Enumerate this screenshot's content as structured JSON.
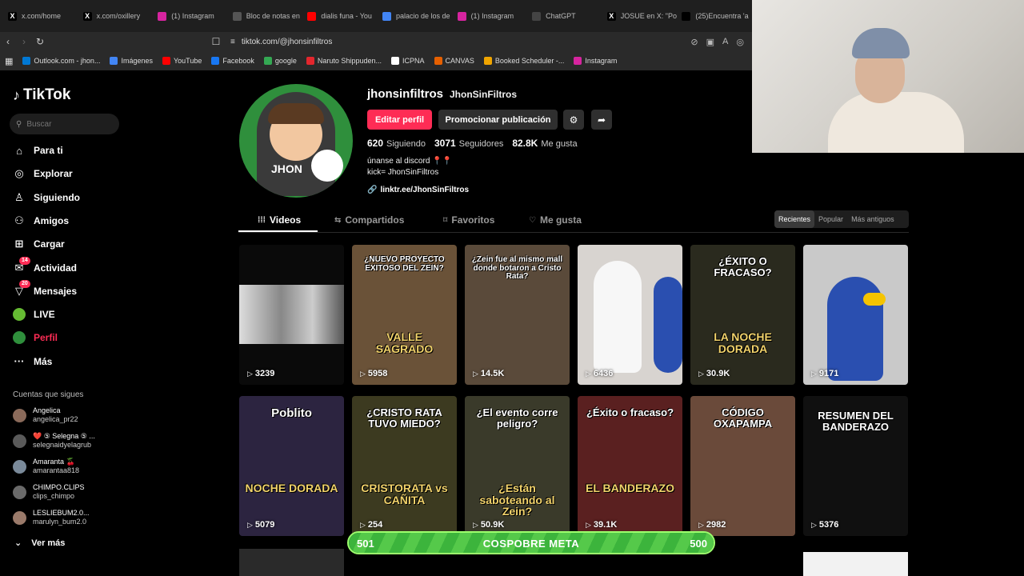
{
  "browser": {
    "tabs": [
      {
        "label": "x.com/home",
        "color": "#000000",
        "glyph": "X"
      },
      {
        "label": "x.com/oxillery",
        "color": "#000000",
        "glyph": "X"
      },
      {
        "label": "(1) Instagram",
        "color": "#d6249f",
        "glyph": ""
      },
      {
        "label": "Bloc de notas en",
        "color": "#555555",
        "glyph": ""
      },
      {
        "label": "dialis funa - You",
        "color": "#ff0000",
        "glyph": ""
      },
      {
        "label": "palacio de los de",
        "color": "#4285f4",
        "glyph": ""
      },
      {
        "label": "(1) Instagram",
        "color": "#d6249f",
        "glyph": ""
      },
      {
        "label": "ChatGPT",
        "color": "#444444",
        "glyph": ""
      },
      {
        "label": "JOSUE en X: \"Po",
        "color": "#000000",
        "glyph": "X"
      },
      {
        "label": "(25)Encuentra 'a",
        "color": "#000000",
        "glyph": ""
      }
    ],
    "url": "tiktok.com/@jhonsinfiltros",
    "bookmarks": [
      {
        "label": "Outlook.com - jhon...",
        "color": "#0078d4"
      },
      {
        "label": "Imágenes",
        "color": "#4285f4"
      },
      {
        "label": "YouTube",
        "color": "#ff0000"
      },
      {
        "label": "Facebook",
        "color": "#1877f2"
      },
      {
        "label": "google",
        "color": "#34a853"
      },
      {
        "label": "Naruto Shippuden...",
        "color": "#e3262d"
      },
      {
        "label": "ICPNA",
        "color": "#ffffff"
      },
      {
        "label": "CANVAS",
        "color": "#e66000"
      },
      {
        "label": "Booked Scheduler -...",
        "color": "#f0a500"
      },
      {
        "label": "Instagram",
        "color": "#d6249f"
      }
    ]
  },
  "sidebar": {
    "logo": "TikTok",
    "search_placeholder": "Buscar",
    "items": [
      {
        "label": "Para ti",
        "icon": "home-icon"
      },
      {
        "label": "Explorar",
        "icon": "compass-icon"
      },
      {
        "label": "Siguiendo",
        "icon": "following-icon"
      },
      {
        "label": "Amigos",
        "icon": "friends-icon"
      },
      {
        "label": "Cargar",
        "icon": "upload-icon"
      },
      {
        "label": "Actividad",
        "icon": "activity-icon",
        "badge": "14"
      },
      {
        "label": "Mensajes",
        "icon": "messages-icon",
        "badge": "20"
      },
      {
        "label": "LIVE",
        "icon": "live-icon"
      },
      {
        "label": "Perfil",
        "icon": "profile-icon",
        "active": true
      },
      {
        "label": "Más",
        "icon": "more-icon"
      }
    ],
    "following_title": "Cuentas que sigues",
    "following": [
      {
        "name": "Angelica",
        "user": "angelica_pr22",
        "color": "#8a6a5a"
      },
      {
        "name": "❤️ ⑤ Selegna ⑤ ...",
        "user": "selegnaidyelagrub",
        "color": "#5a5a5a"
      },
      {
        "name": "Amaranta 🍒",
        "user": "amarantaa818",
        "color": "#7a8a9a"
      },
      {
        "name": "CHIMPO.CLIPS",
        "user": "clips_chimpo",
        "color": "#6a6a6a"
      },
      {
        "name": "LESLIEBUM2.0...",
        "user": "marulyn_bum2.0",
        "color": "#9a7a6a"
      }
    ],
    "see_more": "Ver más"
  },
  "profile": {
    "username": "jhonsinfiltros",
    "nickname": "JhonSinFiltros",
    "avatar_text": "JHON",
    "edit_label": "Editar perfil",
    "promo_label": "Promocionar publicación",
    "stats": [
      {
        "value": "620",
        "label": "Siguiendo"
      },
      {
        "value": "3071",
        "label": "Seguidores"
      },
      {
        "value": "82.8K",
        "label": "Me gusta"
      }
    ],
    "bio_line1": "únanse al discord 📍📍",
    "bio_line2": "kick= JhonSinFiltros",
    "link": "linktr.ee/JhonSinFiltros",
    "accent": "#fe2c55"
  },
  "tabs": [
    {
      "label": "Videos",
      "icon": "grid-icon",
      "active": true
    },
    {
      "label": "Compartidos",
      "icon": "repost-icon"
    },
    {
      "label": "Favoritos",
      "icon": "bookmark-icon"
    },
    {
      "label": "Me gusta",
      "icon": "heart-icon"
    }
  ],
  "sort": [
    "Recientes",
    "Popular",
    "Más antiguos"
  ],
  "videos": [
    {
      "views": "3239",
      "caption": "",
      "bg": "#bdbdbd"
    },
    {
      "views": "5958",
      "caption": "¿NUEVO PROYECTO EXITOSO DEL ZEIN?",
      "caption2": "VALLE SAGRADO",
      "bg": "#6a5238"
    },
    {
      "views": "14.5K",
      "caption": "¿Zein fue al mismo mall donde botaron a Cristo Rata?",
      "bg": "#5a4a3a"
    },
    {
      "views": "6436",
      "caption": "",
      "bg": "#d8d4d0"
    },
    {
      "views": "30.9K",
      "caption": "¿ÉXITO O FRACASO?",
      "caption2": "LA NOCHE DORADA",
      "bg": "#2a2a1e"
    },
    {
      "views": "9171",
      "caption": "",
      "bg": "#c9c9c9"
    },
    {
      "views": "5079",
      "caption": "Poblito",
      "caption2": "NOCHE DORADA",
      "bg": "#2c2440"
    },
    {
      "views": "254",
      "caption": "¿CRISTO RATA TUVO MIEDO?",
      "caption2": "CRISTORATA vs CAÑITA",
      "bg": "#3c3a20"
    },
    {
      "views": "50.9K",
      "caption": "¿El evento corre peligro?",
      "caption2": "¿Están saboteando al Zein?",
      "bg": "#3a3a2a"
    },
    {
      "views": "39.1K",
      "caption": "¿Éxito o fracaso?",
      "caption2": "EL BANDERAZO",
      "bg": "#5a2020"
    },
    {
      "views": "2982",
      "caption": "CÓDIGO OXAPAMPA",
      "bg": "#6a4a3a"
    },
    {
      "views": "5376",
      "caption": "RESUMEN DEL BANDERAZO",
      "bg": "#101010"
    }
  ],
  "meta_bar": {
    "left": "501",
    "center": "COSPOBRE META",
    "right": "500",
    "progress": 1.0
  }
}
